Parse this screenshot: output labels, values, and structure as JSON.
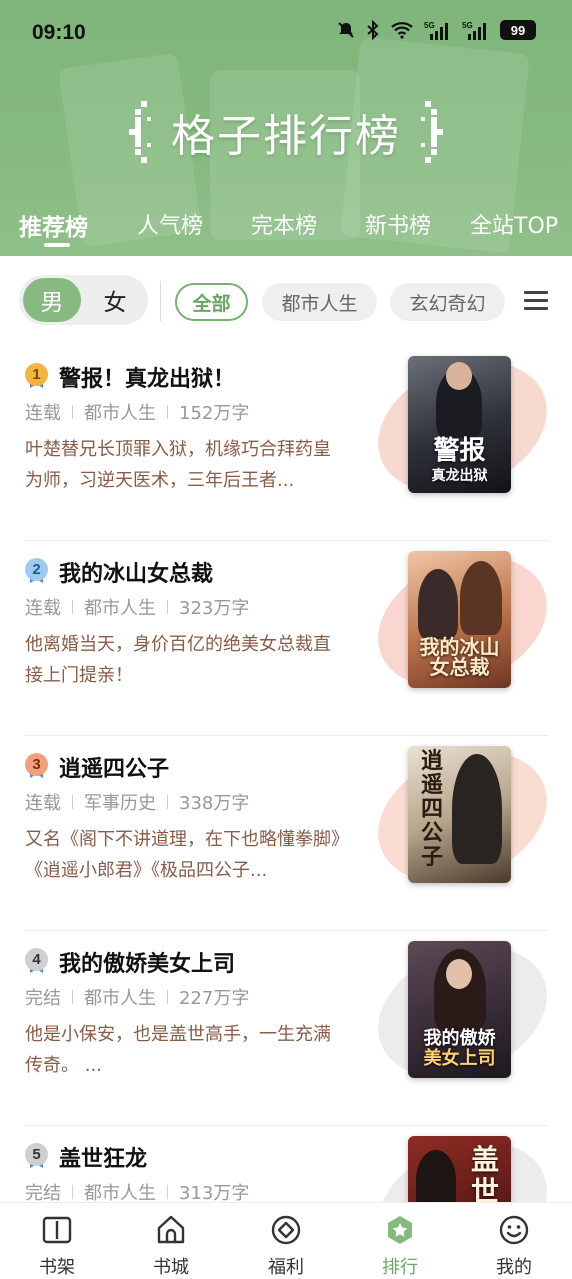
{
  "status_bar": {
    "time": "09:10",
    "battery": "99"
  },
  "header": {
    "title": "格子排行榜",
    "tabs": [
      {
        "label": "推荐榜",
        "active": true
      },
      {
        "label": "人气榜",
        "active": false
      },
      {
        "label": "完本榜",
        "active": false
      },
      {
        "label": "新书榜",
        "active": false
      },
      {
        "label": "全站TOP",
        "active": false
      }
    ]
  },
  "filters": {
    "gender": {
      "male": "男",
      "female": "女",
      "selected": "男"
    },
    "categories": [
      {
        "label": "全部",
        "active": true
      },
      {
        "label": "都市人生",
        "active": false
      },
      {
        "label": "玄幻奇幻",
        "active": false
      }
    ]
  },
  "books": [
    {
      "rank": "1",
      "title": "警报！真龙出狱！",
      "status": "连载",
      "category": "都市人生",
      "words": "152万字",
      "desc": "叶楚替兄长顶罪入狱，机缘巧合拜药皇为师，习逆天医术，三年后王者...",
      "cover_text": "警报",
      "cover_sub": "真龙出狱",
      "medal_color": "#f2b640",
      "ribbon_color": "#4a90d9",
      "blob_color": "#f7d9cf"
    },
    {
      "rank": "2",
      "title": "我的冰山女总裁",
      "status": "连载",
      "category": "都市人生",
      "words": "323万字",
      "desc": "他离婚当天，身价百亿的绝美女总裁直接上门提亲！",
      "cover_text": "我的冰山",
      "cover_sub": "女总裁",
      "medal_color": "#7fb6e6",
      "ribbon_color": "#4a90d9",
      "blob_color": "#f9d7d0"
    },
    {
      "rank": "3",
      "title": "逍遥四公子",
      "status": "连载",
      "category": "军事历史",
      "words": "338万字",
      "desc": "又名《阁下不讲道理，在下也略懂拳脚》《逍遥小郎君》《极品四公子...",
      "cover_text": "逍遥四公子",
      "cover_sub": "",
      "medal_color": "#f0a07a",
      "ribbon_color": "#4a90d9",
      "blob_color": "#fadcd2"
    },
    {
      "rank": "4",
      "title": "我的傲娇美女上司",
      "status": "完结",
      "category": "都市人生",
      "words": "227万字",
      "desc": "他是小保安，也是盖世高手，一生充满传奇。 ...",
      "cover_text": "我的傲娇",
      "cover_sub": "美女上司",
      "medal_color": "#c9c9c9",
      "ribbon_color": "#4a90d9",
      "blob_color": "#ececec"
    },
    {
      "rank": "5",
      "title": "盖世狂龙",
      "status": "完结",
      "category": "都市人生",
      "words": "313万字",
      "desc": "",
      "cover_text": "盖世",
      "cover_sub": "",
      "medal_color": "#c9c9c9",
      "ribbon_color": "#4a90d9",
      "blob_color": "#ececec"
    }
  ],
  "bottom_nav": [
    {
      "label": "书架",
      "icon": "bookshelf-icon",
      "active": false
    },
    {
      "label": "书城",
      "icon": "bookstore-icon",
      "active": false
    },
    {
      "label": "福利",
      "icon": "welfare-icon",
      "active": false
    },
    {
      "label": "排行",
      "icon": "ranking-icon",
      "active": true
    },
    {
      "label": "我的",
      "icon": "profile-icon",
      "active": false
    }
  ],
  "colors": {
    "accent": "#86ba80",
    "accent_text": "#6aa964",
    "desc_text": "#8a5c48"
  }
}
